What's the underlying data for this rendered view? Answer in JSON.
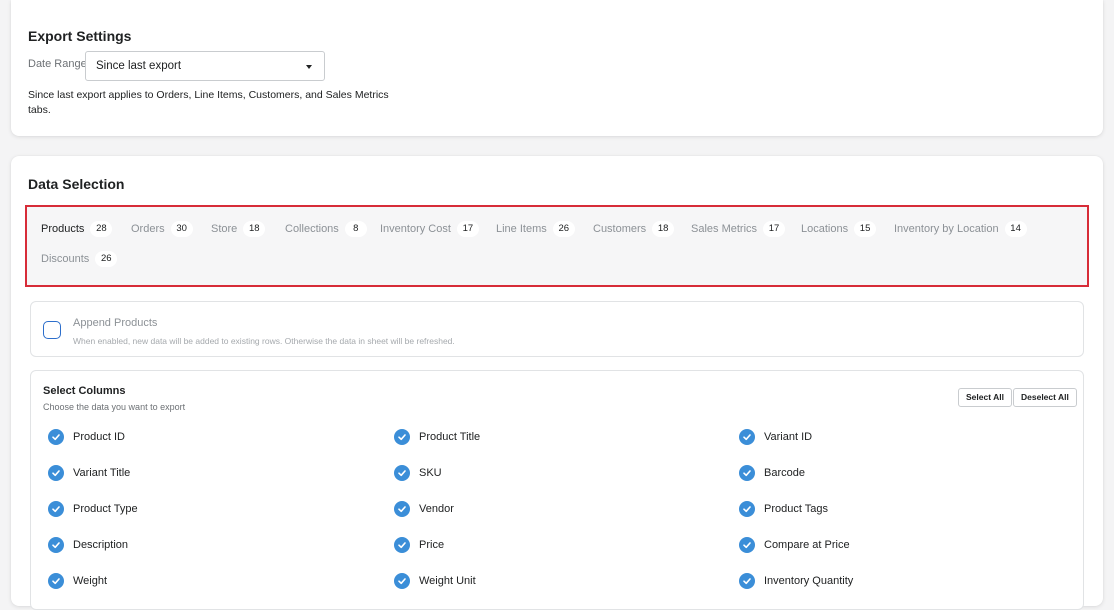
{
  "export_settings": {
    "title": "Export Settings",
    "date_range_label": "Date Range",
    "date_range_value": "Since last export",
    "help_text": "Since last export applies to Orders, Line Items, Customers, and Sales Metrics tabs."
  },
  "data_selection": {
    "title": "Data Selection",
    "tabs": [
      {
        "label": "Products",
        "count": "28"
      },
      {
        "label": "Orders",
        "count": "30"
      },
      {
        "label": "Store",
        "count": "18"
      },
      {
        "label": "Collections",
        "count": "8"
      },
      {
        "label": "Inventory Cost",
        "count": "17"
      },
      {
        "label": "Line Items",
        "count": "26"
      },
      {
        "label": "Customers",
        "count": "18"
      },
      {
        "label": "Sales Metrics",
        "count": "17"
      },
      {
        "label": "Locations",
        "count": "15"
      },
      {
        "label": "Inventory by Location",
        "count": "14"
      },
      {
        "label": "Discounts",
        "count": "26"
      }
    ],
    "active_tab": "Products"
  },
  "append": {
    "title": "Append Products",
    "description": "When enabled, new data will be added to existing rows. Otherwise the data in sheet will be refreshed.",
    "checked": false
  },
  "columns": {
    "title": "Select Columns",
    "subtitle": "Choose the data you want to export",
    "select_all_label": "Select All",
    "deselect_all_label": "Deselect All",
    "items": [
      "Product ID",
      "Product Title",
      "Variant ID",
      "Variant Title",
      "SKU",
      "Barcode",
      "Product Type",
      "Vendor",
      "Product Tags",
      "Description",
      "Price",
      "Compare at Price",
      "Weight",
      "Weight Unit",
      "Inventory Quantity"
    ]
  },
  "colors": {
    "accent": "#3b8ed8",
    "highlight_border": "#d72c38"
  }
}
